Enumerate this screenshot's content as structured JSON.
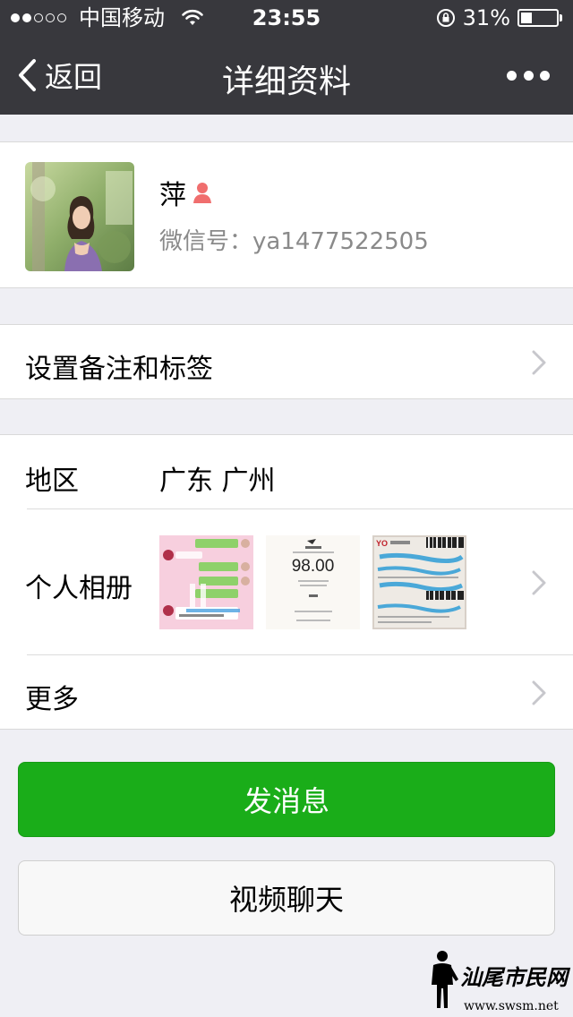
{
  "status_bar": {
    "carrier": "中国移动",
    "time": "23:55",
    "battery_percent": "31%",
    "signal_bars_filled": 2,
    "signal_bars_total": 5,
    "battery_level": 0.31
  },
  "nav": {
    "back_label": "返回",
    "title": "详细资料",
    "more_icon": "ellipsis-icon"
  },
  "profile": {
    "nickname": "萍",
    "gender_icon": "female-icon",
    "wechat_id": "微信号：ya1477522505"
  },
  "remark_row": {
    "label": "设置备注和标签"
  },
  "details": {
    "region_label": "地区",
    "region_value": "广东  广州",
    "album_label": "个人相册",
    "album_thumbs": [
      {
        "kind": "chat-screenshot"
      },
      {
        "kind": "payment-receipt",
        "amount": "98.00"
      },
      {
        "kind": "shipping-slip"
      }
    ],
    "more_label": "更多"
  },
  "buttons": {
    "send_message": "发消息",
    "video_chat": "视频聊天"
  },
  "watermark": {
    "title": "汕尾市民网",
    "url": "www.swsm.net"
  },
  "colors": {
    "nav_bg": "#38383d",
    "page_bg": "#efeff4",
    "send_button": "#1aad19",
    "secondary_text": "#8a8a8a"
  }
}
